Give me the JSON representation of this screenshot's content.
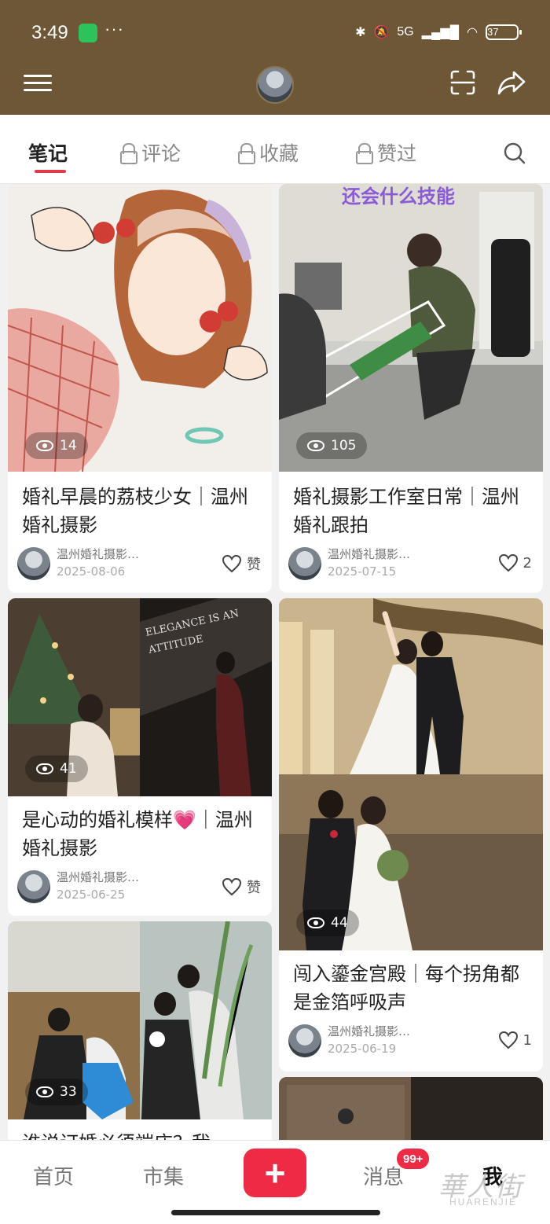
{
  "status_bar": {
    "time": "3:49",
    "network": "5G",
    "battery": "37"
  },
  "tabs": [
    {
      "label": "笔记",
      "locked": false,
      "active": true
    },
    {
      "label": "评论",
      "locked": true,
      "active": false
    },
    {
      "label": "收藏",
      "locked": true,
      "active": false
    },
    {
      "label": "赞过",
      "locked": true,
      "active": false
    }
  ],
  "notes": [
    {
      "views": "14",
      "title": "婚礼早晨的荔枝少女｜温州婚礼摄影",
      "author": "温州婚礼摄影…",
      "date": "2025-08-06",
      "likes": "赞"
    },
    {
      "views": "105",
      "title": "婚礼摄影工作室日常｜温州婚礼跟拍",
      "author": "温州婚礼摄影…",
      "date": "2025-07-15",
      "likes": "2"
    },
    {
      "views": "41",
      "title": "是心动的婚礼模样💗｜温州婚礼摄影",
      "author": "温州婚礼摄影…",
      "date": "2025-06-25",
      "likes": "赞"
    },
    {
      "views": "44",
      "title": "闯入鎏金宫殿｜每个拐角都是金箔呼吸声",
      "author": "温州婚礼摄影…",
      "date": "2025-06-19",
      "likes": "1"
    },
    {
      "views": "33",
      "title": "谁说订婚必须端庄？我"
    }
  ],
  "bottom_nav": {
    "home": "首页",
    "market": "市集",
    "add": "+",
    "messages": "消息",
    "messages_badge": "99+",
    "me": "我"
  },
  "watermark": {
    "cn": "華人街",
    "en": "HUARENJIE"
  }
}
